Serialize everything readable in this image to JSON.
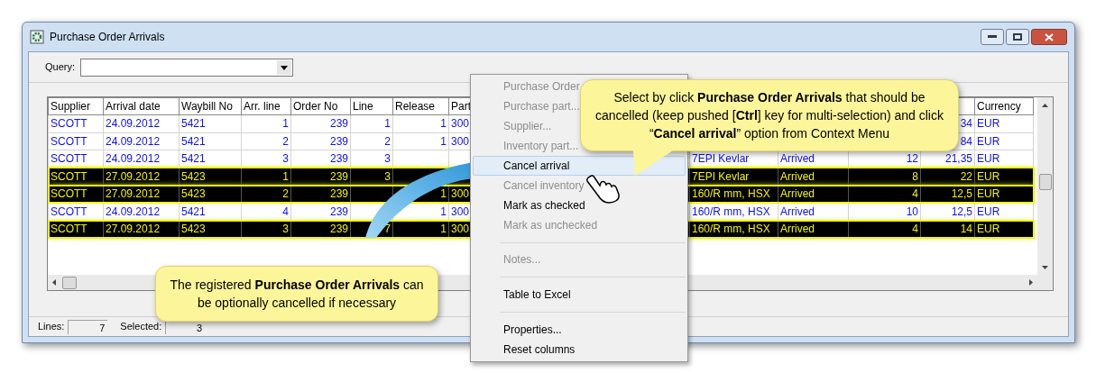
{
  "window": {
    "title": "Purchase Order Arrivals"
  },
  "query": {
    "label": "Query:"
  },
  "table": {
    "columns": [
      "Supplier",
      "Arrival date",
      "Waybill No",
      "Arr. line",
      "Order No",
      "Line",
      "Release",
      "Part",
      null,
      null,
      null,
      null,
      null,
      "Currency"
    ],
    "rows": [
      {
        "selected": false,
        "cells": [
          "SCOTT",
          "24.09.2012",
          "5421",
          "1",
          "239",
          "1",
          "1",
          "300",
          null,
          null,
          null,
          null,
          "34",
          "EUR"
        ]
      },
      {
        "selected": false,
        "cells": [
          "SCOTT",
          "24.09.2012",
          "5421",
          "2",
          "239",
          "2",
          "1",
          "300",
          null,
          null,
          null,
          null,
          "84",
          "EUR"
        ]
      },
      {
        "selected": false,
        "cells": [
          "SCOTT",
          "24.09.2012",
          "5421",
          "3",
          "239",
          "3",
          null,
          null,
          null,
          "7EPI Kevlar",
          "Arrived",
          "12",
          "21,35",
          "EUR"
        ]
      },
      {
        "selected": true,
        "cells": [
          "SCOTT",
          "27.09.2012",
          "5423",
          "1",
          "239",
          "3",
          null,
          null,
          null,
          "7EPI Kevlar",
          "Arrived",
          "8",
          "22",
          "EUR"
        ]
      },
      {
        "selected": true,
        "cells": [
          "SCOTT",
          "27.09.2012",
          "5423",
          "2",
          "239",
          null,
          "1",
          "300",
          null,
          "160/R mm, HSX",
          "Arrived",
          "4",
          "12,5",
          "EUR"
        ]
      },
      {
        "selected": false,
        "cells": [
          "SCOTT",
          "24.09.2012",
          "5421",
          "4",
          "239",
          null,
          "1",
          "300",
          null,
          "160/R mm, HSX",
          "Arrived",
          "10",
          "12,5",
          "EUR"
        ]
      },
      {
        "selected": true,
        "cells": [
          "SCOTT",
          "27.09.2012",
          "5423",
          "3",
          "239",
          "7",
          "1",
          "300",
          null,
          "160/R mm, HSX",
          "Arrived",
          "4",
          "14",
          "EUR"
        ]
      }
    ]
  },
  "status_bar": {
    "lines_label": "Lines:",
    "lines_value": "7",
    "selected_label": "Selected:",
    "selected_value": "3"
  },
  "context_menu": {
    "items": [
      {
        "kind": "item",
        "label": "Purchase Order",
        "disabled": true,
        "selected": false
      },
      {
        "kind": "item",
        "label": "Purchase part...",
        "disabled": true,
        "selected": false
      },
      {
        "kind": "item",
        "label": "Supplier...",
        "disabled": true,
        "selected": false
      },
      {
        "kind": "item",
        "label": "Inventory part...",
        "disabled": true,
        "selected": false
      },
      {
        "kind": "item",
        "label": "Cancel arrival",
        "disabled": false,
        "selected": true
      },
      {
        "kind": "item",
        "label": "Cancel inventory",
        "disabled": true,
        "selected": false
      },
      {
        "kind": "item",
        "label": "Mark as checked",
        "disabled": false,
        "selected": false
      },
      {
        "kind": "item",
        "label": "Mark as unchecked",
        "disabled": true,
        "selected": false
      },
      {
        "kind": "separator"
      },
      {
        "kind": "item",
        "label": "Notes...",
        "disabled": true,
        "selected": false
      },
      {
        "kind": "separator"
      },
      {
        "kind": "item",
        "label": "Table to Excel",
        "disabled": false,
        "selected": false
      },
      {
        "kind": "separator"
      },
      {
        "kind": "item",
        "label": "Properties...",
        "disabled": false,
        "selected": false
      },
      {
        "kind": "item",
        "label": "Reset columns",
        "disabled": false,
        "selected": false
      }
    ]
  },
  "callouts": [
    {
      "text": "Select by click **Purchase Order Arrivals** that should be cancelled (keep pushed [**Ctrl**] key for multi-selection) and click “**Cancel arrival**” option from Context Menu"
    },
    {
      "text": "The registered **Purchase Order Arrivals** can be optionally cancelled if necessary"
    }
  ]
}
